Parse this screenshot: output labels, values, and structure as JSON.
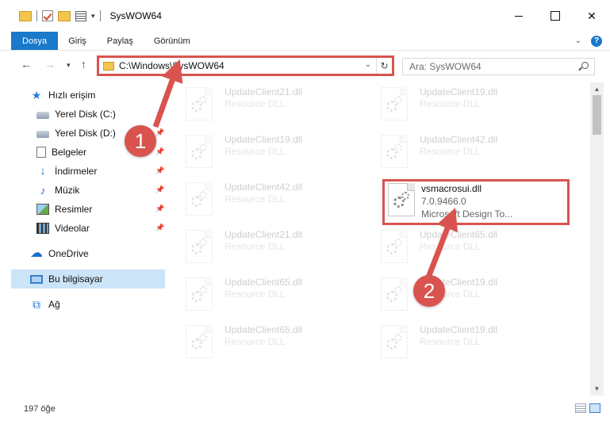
{
  "window": {
    "title": "SysWOW64"
  },
  "ribbon": {
    "tabs": [
      "Dosya",
      "Giriş",
      "Paylaş",
      "Görünüm"
    ]
  },
  "address": {
    "path": "C:\\Windows\\SysWOW64"
  },
  "search": {
    "placeholder": "Ara: SysWOW64"
  },
  "sidebar": {
    "items": [
      {
        "label": "Hızlı erişim",
        "icon": "star-icon"
      },
      {
        "label": "Yerel Disk (C:)",
        "icon": "drive-icon"
      },
      {
        "label": "Yerel Disk (D:)",
        "icon": "drive-icon"
      },
      {
        "label": "Belgeler",
        "icon": "documents-icon"
      },
      {
        "label": "İndirmeler",
        "icon": "download-icon"
      },
      {
        "label": "Müzik",
        "icon": "music-icon"
      },
      {
        "label": "Resimler",
        "icon": "pictures-icon"
      },
      {
        "label": "Videolar",
        "icon": "videos-icon"
      },
      {
        "label": "OneDrive",
        "icon": "cloud-icon"
      },
      {
        "label": "Bu bilgisayar",
        "icon": "computer-icon"
      },
      {
        "label": "Ağ",
        "icon": "network-icon"
      }
    ]
  },
  "files": [
    {
      "name": "UpdateClient21.dll",
      "type": "Resource DLL"
    },
    {
      "name": "UpdateClient19.dll",
      "type": "Resource DLL"
    },
    {
      "name": "UpdateClient19.dll",
      "type": "Resource DLL"
    },
    {
      "name": "UpdateClient42.dll",
      "type": "Resource DLL"
    },
    {
      "name": "UpdateClient42.dll",
      "type": "Resource DLL"
    },
    {
      "name": "vsmacrosui.dll",
      "version": "7.0.9466.0",
      "company": "Microsoft Design To..."
    },
    {
      "name": "UpdateClient21.dll",
      "type": "Resource DLL"
    },
    {
      "name": "UpdateClient65.dll",
      "type": "Resource DLL"
    },
    {
      "name": "UpdateClient65.dll",
      "type": "Resource DLL"
    },
    {
      "name": "UpdateClient19.dll",
      "type": "Resource DLL"
    },
    {
      "name": "UpdateClient65.dll",
      "type": "Resource DLL"
    },
    {
      "name": "UpdateClient19.dll",
      "type": "Resource DLL"
    }
  ],
  "status": {
    "count": "197 öğe"
  },
  "annotations": {
    "step1": "1",
    "step2": "2",
    "color": "#d9534f"
  }
}
